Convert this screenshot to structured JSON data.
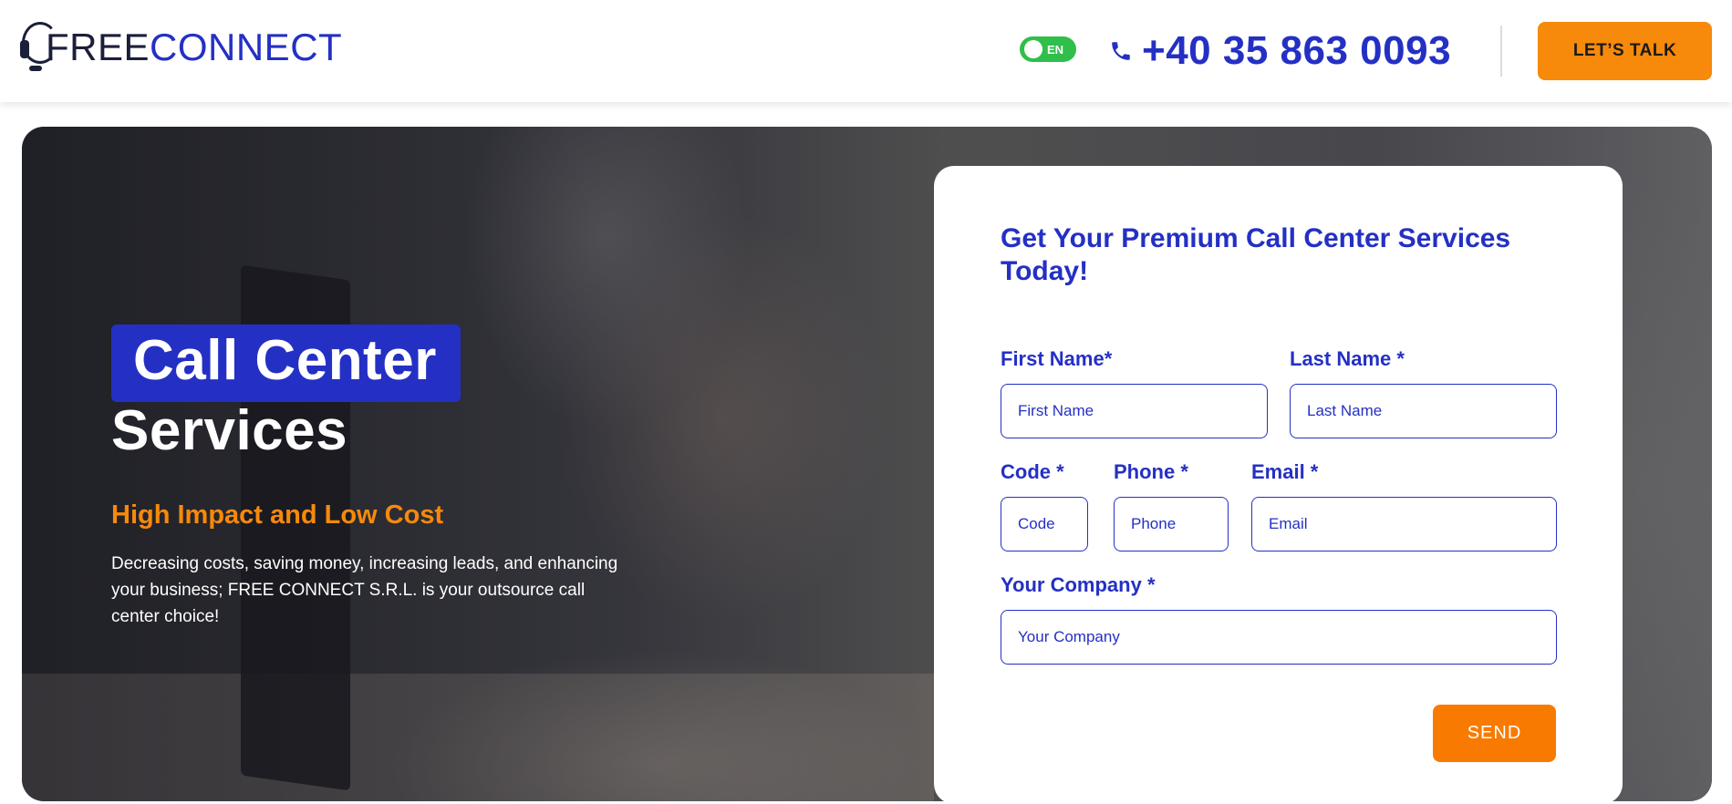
{
  "header": {
    "logo": {
      "part1": "FREE",
      "part2": "CONNECT",
      "icon": "headset-icon"
    },
    "language_toggle": {
      "label": "EN",
      "state": "on",
      "color": "#2fbf4a"
    },
    "phone": {
      "icon": "phone-icon",
      "number": "+40 35 863 0093"
    },
    "cta_label": "LET’S TALK"
  },
  "hero": {
    "title_highlight": "Call Center",
    "title_rest": "Services",
    "subtitle": "High Impact and Low Cost",
    "description": "Decreasing costs, saving money, increasing leads, and enhancing your business; FREE CONNECT S.R.L. is your outsource call center choice!"
  },
  "form": {
    "heading": "Get Your Premium Call Center Services Today!",
    "fields": {
      "first_name": {
        "label": "First Name*",
        "placeholder": "First Name"
      },
      "last_name": {
        "label": "Last Name *",
        "placeholder": "Last Name"
      },
      "code": {
        "label": "Code *",
        "placeholder": "Code"
      },
      "phone": {
        "label": "Phone *",
        "placeholder": "Phone"
      },
      "email": {
        "label": "Email *",
        "placeholder": "Email"
      },
      "company": {
        "label": "Your Company *",
        "placeholder": "Your Company"
      }
    },
    "send_label": "SEND"
  },
  "colors": {
    "brand_blue": "#2430c4",
    "accent_orange": "#f7890b",
    "toggle_green": "#2fbf4a"
  }
}
